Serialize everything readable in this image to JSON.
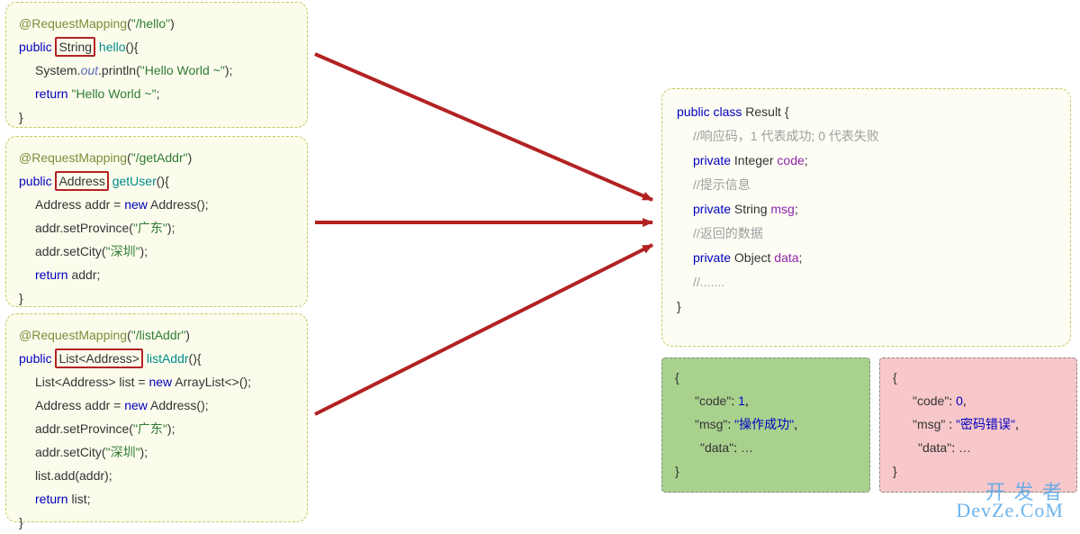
{
  "box1": {
    "l1a": "@RequestMapping",
    "l1b": "(",
    "l1c": "\"/hello\"",
    "l1d": ")",
    "l2a": "public ",
    "l2b_ret": "String",
    "l2c": " hello",
    "l2d": "(){",
    "l3a": "System.",
    "l3b": "out",
    "l3c": ".println(",
    "l3d": "\"Hello World ~\"",
    "l3e": ");",
    "l4a": "return ",
    "l4b": "\"Hello World ~\"",
    "l4c": ";",
    "l5": "}"
  },
  "box2": {
    "l1a": "@RequestMapping",
    "l1b": "(",
    "l1c": "\"/getAddr\"",
    "l1d": ")",
    "l2a": "public ",
    "l2b_ret": "Address",
    "l2c": " getUser",
    "l2d": "(){",
    "l3a": "Address addr = ",
    "l3b": "new ",
    "l3c": "Address();",
    "l4a": "addr.setProvince(",
    "l4b": "\"广东\"",
    "l4c": ");",
    "l5a": "addr.setCity(",
    "l5b": "\"深圳\"",
    "l5c": ");",
    "l6a": "return ",
    "l6b": "addr;",
    "l7": "}"
  },
  "box3": {
    "l1a": "@RequestMapping",
    "l1b": "(",
    "l1c": "\"/listAddr\"",
    "l1d": ")",
    "l2a": "public ",
    "l2b_ret": "List<Address>",
    "l2c": " listAddr",
    "l2d": "(){",
    "l3a": "List<Address> list = ",
    "l3b": "new ",
    "l3c": "ArrayList<>();",
    "l4a": "Address addr = ",
    "l4b": "new ",
    "l4c": "Address();",
    "l5a": "addr.setProvince(",
    "l5b": "\"广东\"",
    "l5c": ");",
    "l6a": "addr.setCity(",
    "l6b": "\"深圳\"",
    "l6c": ");",
    "l7": "list.add(addr);",
    "l8a": "return ",
    "l8b": "list;",
    "l9": "}"
  },
  "result": {
    "l1a": "public class ",
    "l1b": "Result {",
    "c1": "//响应码，1 代表成功; 0 代表失败",
    "l2a": "private ",
    "l2b": "Integer ",
    "l2c": "code",
    "l2d": ";",
    "c2": "//提示信息",
    "l3a": "private ",
    "l3b": "String ",
    "l3c": "msg",
    "l3d": ";",
    "c3": "//返回的数据",
    "l4a": "private ",
    "l4b": "Object ",
    "l4c": "data",
    "l4d": ";",
    "c4": "//.......",
    "l5": "}"
  },
  "jsonGreen": {
    "open": "{",
    "k1": "\"code\"",
    "v1": "1",
    "s1": ": ",
    "e1": ",",
    "k2": "\"msg\"",
    "v2": "\"操作成功\"",
    "s2": ": ",
    "e2": ",",
    "k3": "\"data\"",
    "v3": "…",
    "s3": ": ",
    "close": "}"
  },
  "jsonRed": {
    "open": "{",
    "k1": "\"code\"",
    "v1": "0",
    "s1": ": ",
    "e1": ",",
    "k2": "\"msg\"",
    "v2": "\"密码错误\"",
    "s2": " : ",
    "e2": ",",
    "k3": "\"data\"",
    "v3": "…",
    "s3": ": ",
    "close": "}"
  },
  "watermark": {
    "line1": "开 发 者",
    "line2": "DevZe.CoM"
  },
  "colors": {
    "arrow": "#b22222",
    "boxBorder": "#c7c760",
    "greenBg": "#a9d18e",
    "redBg": "#f7c7c9"
  }
}
